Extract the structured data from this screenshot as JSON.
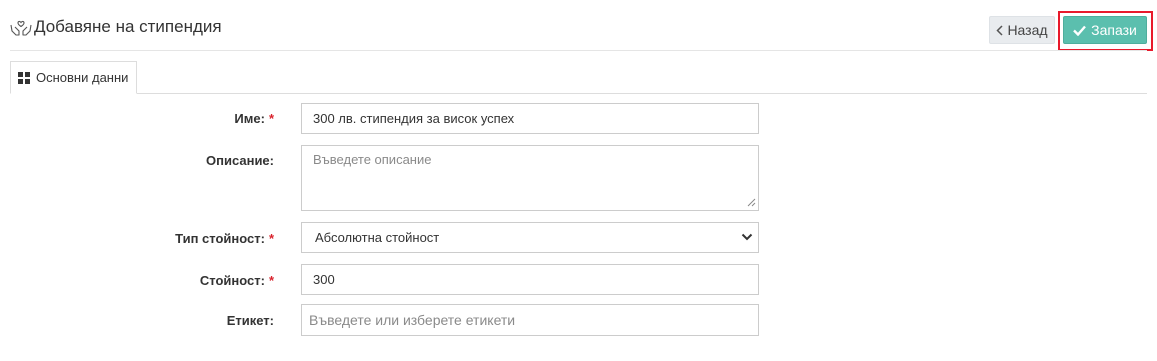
{
  "header": {
    "title": "Добавяне на стипендия",
    "back_label": "Назад",
    "save_label": "Запази",
    "title_icon": "hands-heart-icon",
    "accent_color": "#5bbfae",
    "highlight_color": "#e8192b"
  },
  "tabs": [
    {
      "label": "Основни данни",
      "icon": "grid-icon",
      "active": true
    }
  ],
  "form": {
    "name": {
      "label": "Име:",
      "required_mark": "*",
      "value": "300 лв. стипендия за висок успех"
    },
    "description": {
      "label": "Описание:",
      "placeholder": "Въведете описание",
      "value": ""
    },
    "value_type": {
      "label": "Тип стойност:",
      "required_mark": "*",
      "selected": "Абсолютна стойност"
    },
    "amount": {
      "label": "Стойност:",
      "required_mark": "*",
      "value": "300"
    },
    "tags": {
      "label": "Етикет:",
      "placeholder": "Въведете или изберете етикети",
      "value": ""
    }
  }
}
